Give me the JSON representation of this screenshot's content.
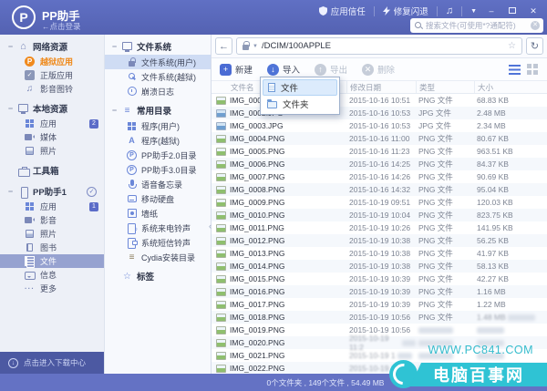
{
  "app": {
    "name": "PP助手",
    "login_hint": "←点击登录",
    "logo_letter": "P"
  },
  "titlebar": {
    "trust_label": "应用信任",
    "fix_label": "修复闪退",
    "search_placeholder": "搜索文件(可使用*?通配符)"
  },
  "sidebar": {
    "groups": [
      {
        "collapse": "−",
        "icon": "home-icon",
        "label": "网络资源",
        "items": [
          {
            "icon": "pp-orange-icon",
            "label": "越狱应用",
            "state": "active-orange"
          },
          {
            "icon": "genuine-icon",
            "label": "正版应用"
          },
          {
            "icon": "music-icon",
            "label": "影音图铃"
          }
        ]
      },
      {
        "collapse": "−",
        "icon": "monitor-icon",
        "label": "本地资源",
        "items": [
          {
            "icon": "grid-icon",
            "label": "应用",
            "badge": "2"
          },
          {
            "icon": "video-icon",
            "label": "媒体"
          },
          {
            "icon": "photo-icon",
            "label": "照片"
          }
        ]
      },
      {
        "collapse": "",
        "icon": "toolbox-icon",
        "label": "工具箱",
        "items": []
      },
      {
        "collapse": "−",
        "icon": "phone-icon",
        "label": "PP助手1",
        "check": true,
        "items": [
          {
            "icon": "grid-icon",
            "label": "应用",
            "badge": "1"
          },
          {
            "icon": "video-icon",
            "label": "影音"
          },
          {
            "icon": "photo-icon",
            "label": "照片"
          },
          {
            "icon": "book-icon",
            "label": "图书"
          },
          {
            "icon": "file-icon",
            "label": "文件",
            "state": "selected"
          },
          {
            "icon": "chat-icon",
            "label": "信息"
          },
          {
            "icon": "more-icon",
            "label": "更多"
          }
        ]
      }
    ],
    "footer": "点击进入下载中心"
  },
  "tree": {
    "sections": [
      {
        "collapse": "−",
        "icon": "monitor-icon",
        "label": "文件系统",
        "items": [
          {
            "icon": "lock-icon",
            "label": "文件系统(用户)",
            "state": "selected"
          },
          {
            "icon": "key-icon",
            "label": "文件系统(越狱)"
          },
          {
            "icon": "clock-icon",
            "label": "崩溃日志"
          }
        ]
      },
      {
        "collapse": "−",
        "icon": "list-icon",
        "label": "常用目录",
        "items": [
          {
            "icon": "grid-icon",
            "label": "程序(用户)"
          },
          {
            "icon": "jb-icon",
            "label": "程序(越狱)"
          },
          {
            "icon": "pp-icon",
            "label": "PP助手2.0目录"
          },
          {
            "icon": "pp-icon",
            "label": "PP助手3.0目录"
          },
          {
            "icon": "mic-icon",
            "label": "语音备忘录"
          },
          {
            "icon": "disk-icon",
            "label": "移动硬盘"
          },
          {
            "icon": "wallpaper-icon",
            "label": "墙纸"
          },
          {
            "icon": "ring-icon",
            "label": "系统来电铃声"
          },
          {
            "icon": "sms-icon",
            "label": "系统短信铃声"
          },
          {
            "icon": "cydia-icon",
            "label": "Cydia安装目录"
          }
        ]
      },
      {
        "collapse": "",
        "icon": "star-icon",
        "label": "标签",
        "items": []
      }
    ]
  },
  "address": {
    "path": "/DCIM/100APPLE"
  },
  "toolbar": {
    "new_label": "新建",
    "import_label": "导入",
    "export_label": "导出",
    "delete_label": "删除"
  },
  "menu": {
    "items": [
      {
        "icon": "file-icon",
        "label": "文件",
        "hot": true
      },
      {
        "icon": "folder-icon",
        "label": "文件夹",
        "hot": false
      }
    ]
  },
  "files": {
    "columns": [
      "文件名",
      "修改日期",
      "类型",
      "大小"
    ],
    "rows": [
      {
        "name": "IMG_0001.PNG",
        "date": "2015-10-16 10:51",
        "type": "PNG 文件",
        "size": "68.83 KB"
      },
      {
        "name": "IMG_0002.JPG",
        "date": "2015-10-16 10:53",
        "type": "JPG 文件",
        "size": "2.48 MB"
      },
      {
        "name": "IMG_0003.JPG",
        "date": "2015-10-16 10:53",
        "type": "JPG 文件",
        "size": "2.34 MB"
      },
      {
        "name": "IMG_0004.PNG",
        "date": "2015-10-16 11:00",
        "type": "PNG 文件",
        "size": "80.67 KB"
      },
      {
        "name": "IMG_0005.PNG",
        "date": "2015-10-16 11:23",
        "type": "PNG 文件",
        "size": "963.51 KB"
      },
      {
        "name": "IMG_0006.PNG",
        "date": "2015-10-16 14:25",
        "type": "PNG 文件",
        "size": "84.37 KB"
      },
      {
        "name": "IMG_0007.PNG",
        "date": "2015-10-16 14:26",
        "type": "PNG 文件",
        "size": "90.69 KB"
      },
      {
        "name": "IMG_0008.PNG",
        "date": "2015-10-16 14:32",
        "type": "PNG 文件",
        "size": "95.04 KB"
      },
      {
        "name": "IMG_0009.PNG",
        "date": "2015-10-19 09:51",
        "type": "PNG 文件",
        "size": "120.03 KB"
      },
      {
        "name": "IMG_0010.PNG",
        "date": "2015-10-19 10:04",
        "type": "PNG 文件",
        "size": "823.75 KB"
      },
      {
        "name": "IMG_0011.PNG",
        "date": "2015-10-19 10:26",
        "type": "PNG 文件",
        "size": "141.95 KB"
      },
      {
        "name": "IMG_0012.PNG",
        "date": "2015-10-19 10:38",
        "type": "PNG 文件",
        "size": "56.25 KB"
      },
      {
        "name": "IMG_0013.PNG",
        "date": "2015-10-19 10:38",
        "type": "PNG 文件",
        "size": "41.97 KB"
      },
      {
        "name": "IMG_0014.PNG",
        "date": "2015-10-19 10:38",
        "type": "PNG 文件",
        "size": "58.13 KB"
      },
      {
        "name": "IMG_0015.PNG",
        "date": "2015-10-19 10:39",
        "type": "PNG 文件",
        "size": "42.27 KB"
      },
      {
        "name": "IMG_0016.PNG",
        "date": "2015-10-19 10:39",
        "type": "PNG 文件",
        "size": "1.16 MB"
      },
      {
        "name": "IMG_0017.PNG",
        "date": "2015-10-19 10:39",
        "type": "PNG 文件",
        "size": "1.22 MB"
      },
      {
        "name": "IMG_0018.PNG",
        "date": "2015-10-19 10:56",
        "type": "PNG 文件",
        "size": "1.48 MB",
        "blur": [
          "size"
        ]
      },
      {
        "name": "IMG_0019.PNG",
        "date": "2015-10-19 10:56",
        "type": "",
        "size": "",
        "blur": [
          "type",
          "size"
        ]
      },
      {
        "name": "IMG_0020.PNG",
        "date": "2015-10-19 11:2",
        "type": "",
        "size": "",
        "blur": [
          "date",
          "type",
          "size"
        ]
      },
      {
        "name": "IMG_0021.PNG",
        "date": "2015-10-19 1",
        "type": "",
        "size": "",
        "blur": [
          "date",
          "type",
          "size"
        ]
      },
      {
        "name": "IMG_0022.PNG",
        "date": "2015-10-19 1",
        "type": "",
        "size": "",
        "blur": [
          "date",
          "type",
          "size"
        ]
      }
    ]
  },
  "statusbar": {
    "summary": "0个文件夹 , 149个文件 , 54.49 MB"
  },
  "watermark": {
    "line1": "WWW.PC841.COM",
    "line2": "电脑百事网"
  },
  "colors": {
    "accent": "#5a6abd",
    "orange": "#f08a1e",
    "teal": "#2fc3d4",
    "selected_sidebar": "#96a2d0",
    "selected_tree": "#cfdcf4"
  }
}
